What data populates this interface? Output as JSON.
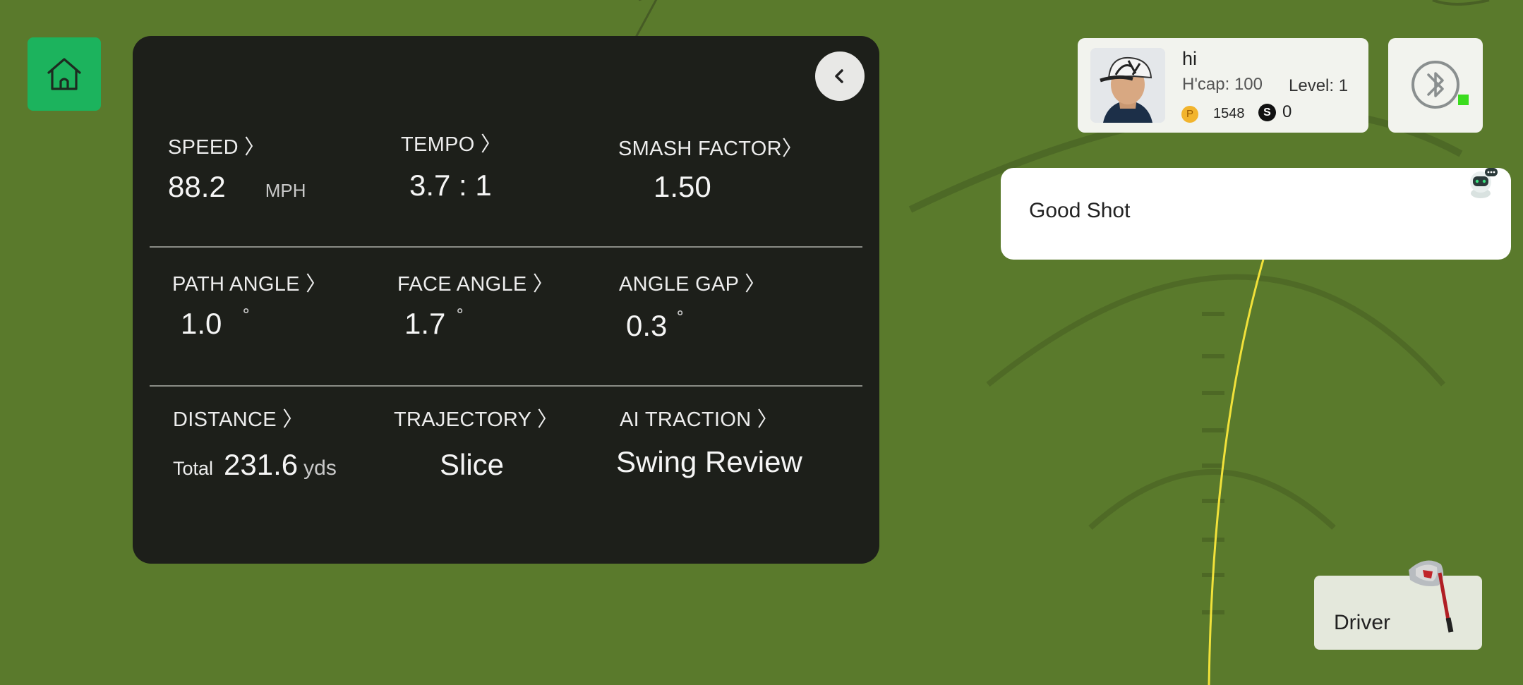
{
  "nav": {
    "home_icon": "home-icon",
    "collapse_icon": "chevron-left-icon"
  },
  "metrics": {
    "speed": {
      "label": "SPEED 〉",
      "value": "88.2",
      "unit": "MPH"
    },
    "tempo": {
      "label": "TEMPO 〉",
      "value": "3.7 : 1"
    },
    "smash": {
      "label": "SMASH FACTOR〉",
      "value": "1.50"
    },
    "path_angle": {
      "label": "PATH ANGLE 〉",
      "value": "1.0",
      "unit": "˚"
    },
    "face_angle": {
      "label": "FACE ANGLE 〉",
      "value": "1.7",
      "unit": "˚"
    },
    "angle_gap": {
      "label": "ANGLE GAP 〉",
      "value": "0.3",
      "unit": "˚"
    },
    "distance": {
      "label": "DISTANCE 〉",
      "prefix": "Total",
      "value": "231.6",
      "unit": "yds"
    },
    "trajectory": {
      "label": "TRAJECTORY 〉",
      "value": "Slice"
    },
    "ai_traction": {
      "label": "AI TRACTION 〉",
      "value": "Swing Review"
    }
  },
  "user": {
    "name": "hi",
    "handicap": "H'cap: 100",
    "level": "Level: 1",
    "points_badge": "P",
    "points": "1548",
    "coins_badge": "S",
    "coins": "0"
  },
  "bluetooth": {
    "icon": "bluetooth-icon",
    "status_color": "#3bdc1e"
  },
  "message": {
    "text": "Good Shot",
    "robot_icon": "robot-icon"
  },
  "club": {
    "name": "Driver",
    "icon": "golf-driver-icon"
  },
  "colors": {
    "fairway": "#5a7a2c",
    "panel": "#1d1f1a",
    "home": "#1cb35d",
    "ball_line": "#f2e23a"
  }
}
